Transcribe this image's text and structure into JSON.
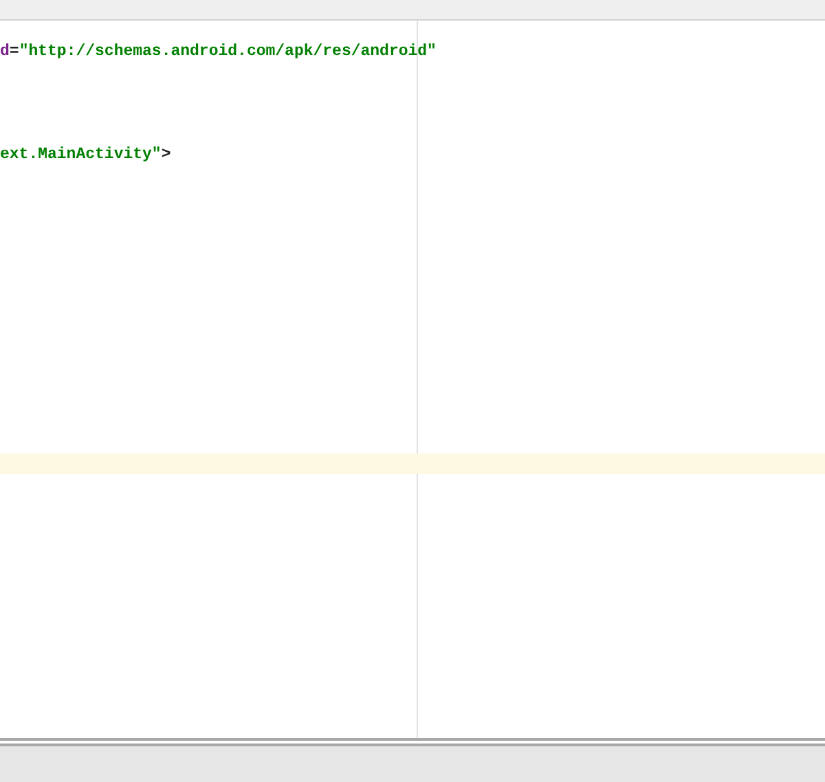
{
  "editor": {
    "lines": [
      {
        "current": false
      },
      {
        "current": false,
        "tokens": [
          {
            "kind": "attr",
            "text": "d"
          },
          {
            "kind": "plain",
            "text": "="
          },
          {
            "kind": "string",
            "text": "\"http://schemas.android.com/apk/res/android\""
          }
        ]
      },
      {
        "current": false
      },
      {
        "current": false
      },
      {
        "current": false
      },
      {
        "current": false
      },
      {
        "current": false,
        "tokens": [
          {
            "kind": "string",
            "text": "ext.MainActivity\""
          },
          {
            "kind": "plain",
            "text": ">"
          }
        ]
      },
      {
        "current": false
      },
      {
        "current": false
      },
      {
        "current": false
      },
      {
        "current": false
      },
      {
        "current": false
      },
      {
        "current": false
      },
      {
        "current": false
      },
      {
        "current": false
      },
      {
        "current": false
      },
      {
        "current": false
      },
      {
        "current": false
      },
      {
        "current": false
      },
      {
        "current": false
      },
      {
        "current": false
      },
      {
        "current": true
      }
    ]
  }
}
